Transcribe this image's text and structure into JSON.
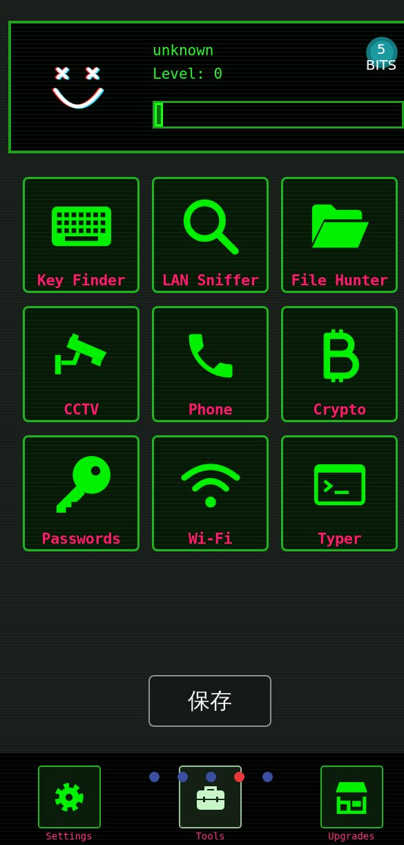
{
  "profile": {
    "name": "unknown",
    "level_label": "Level: 0",
    "level": 0.02
  },
  "bits": {
    "count": "5",
    "label": "BITS"
  },
  "tools": [
    {
      "label": "Key Finder"
    },
    {
      "label": "LAN Sniffer"
    },
    {
      "label": "File Hunter"
    },
    {
      "label": "CCTV"
    },
    {
      "label": "Phone"
    },
    {
      "label": "Crypto"
    },
    {
      "label": "Passwords"
    },
    {
      "label": "Wi-Fi"
    },
    {
      "label": "Typer"
    }
  ],
  "toast": {
    "text": "保存"
  },
  "page_dots": [
    {
      "selected": false
    },
    {
      "selected": false
    },
    {
      "selected": false
    },
    {
      "selected": true
    },
    {
      "selected": false
    }
  ],
  "nav": [
    {
      "label": "Settings",
      "selected": false
    },
    {
      "label": "Tools",
      "selected": true
    },
    {
      "label": "Upgrades",
      "selected": false
    }
  ]
}
